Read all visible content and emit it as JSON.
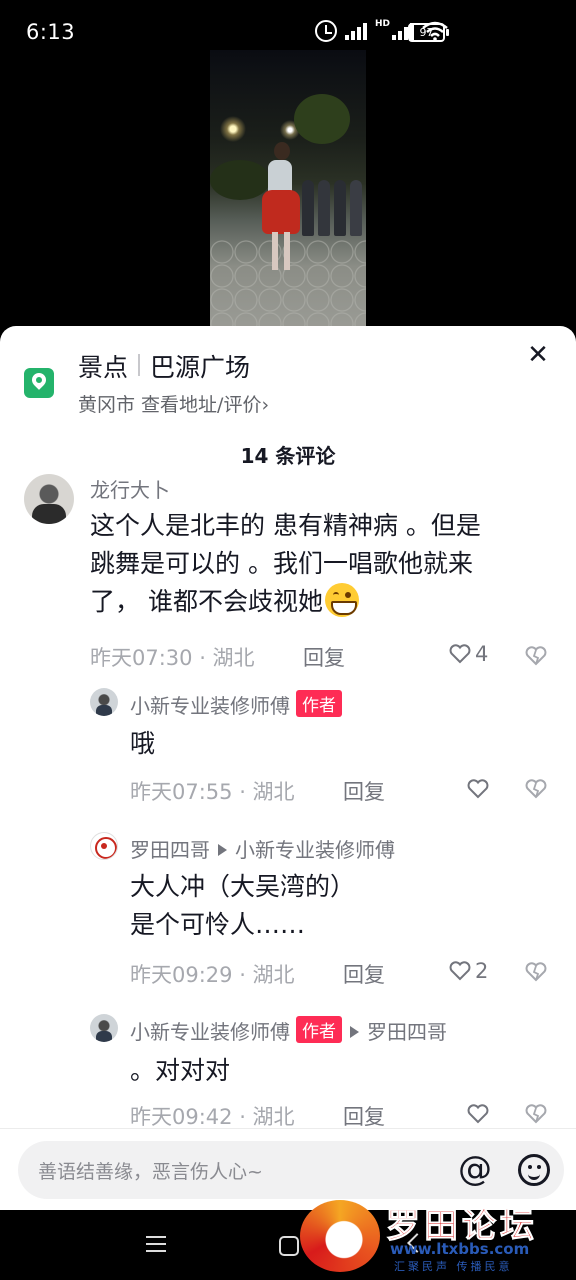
{
  "status_bar": {
    "time": "6:13",
    "battery": "97",
    "signal_label": "HD"
  },
  "location": {
    "type": "景点",
    "name": "巴源广场",
    "sub": "黄冈市 查看地址/评价›"
  },
  "comments_header": {
    "count_text": "14 条评论"
  },
  "comments": [
    {
      "user": "龙行大卜",
      "text_line1": "这个人是北丰的 患有精神病 。但是",
      "text_line2": "跳舞是可以的 。我们一唱歌他就来",
      "text_line3": "了， 谁都不会歧视她",
      "meta": "昨天07:30 · 湖北",
      "reply_label": "回复",
      "likes": "4"
    }
  ],
  "replies": [
    {
      "user": "小新专业装修师傅",
      "author_tag": "作者",
      "text": "哦",
      "meta": "昨天07:55 · 湖北",
      "reply_label": "回复",
      "likes": ""
    },
    {
      "user": "罗田四哥",
      "reply_to": "小新专业装修师傅",
      "text_line1": "大人冲（大吴湾的）",
      "text_line2": "是个可怜人……",
      "meta": "昨天09:29 · 湖北",
      "reply_label": "回复",
      "likes": "2"
    },
    {
      "user": "小新专业装修师傅",
      "author_tag": "作者",
      "reply_to": "罗田四哥",
      "text": "。对对对",
      "meta": "昨天09:42 · 湖北",
      "reply_label": "回复",
      "likes": ""
    }
  ],
  "input": {
    "placeholder": "善语结善缘，恶言伤人心~",
    "at_symbol": "@"
  },
  "watermark": {
    "title": "罗田论坛",
    "url": "www.ltxbbs.com",
    "slogan": "汇聚民声 传播民意"
  },
  "icons": [
    "alarm-icon",
    "signal-icon",
    "wifi-icon",
    "battery-icon",
    "location-pin-icon",
    "close-icon",
    "heart-icon",
    "dislike-icon",
    "at-icon",
    "emoji-icon",
    "menu-icon",
    "home-icon",
    "back-icon"
  ],
  "colors": {
    "accent_red": "#fe2c55",
    "location_green": "#24b36b",
    "text_primary": "#161823",
    "text_secondary": "#73757d"
  }
}
